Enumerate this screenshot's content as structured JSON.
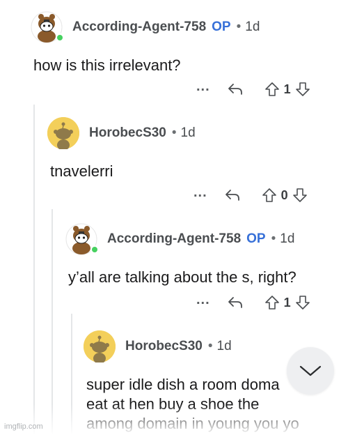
{
  "comments": [
    {
      "username": "According-Agent-758",
      "op_badge": "OP",
      "separator": "•",
      "age": "1d",
      "lines": [
        "how is this irrelevant?"
      ],
      "more": "...",
      "votes": "1",
      "avatar": "snoo-bear-avatar",
      "online": true
    },
    {
      "username": "HorobecS30",
      "separator": "•",
      "age": "1d",
      "lines": [
        "tnavelerri"
      ],
      "more": "...",
      "votes": "0",
      "avatar": "default-snoo-avatar",
      "online": false
    },
    {
      "username": "According-Agent-758",
      "op_badge": "OP",
      "separator": "•",
      "age": "1d",
      "lines": [
        "y’all are talking about the s, right?"
      ],
      "more": "...",
      "votes": "1",
      "avatar": "snoo-bear-avatar",
      "online": true
    },
    {
      "username": "HorobecS30",
      "separator": "•",
      "age": "1d",
      "lines": [
        "super idle dish a room doma",
        "eat at hen buy a shoe the",
        "among domain in young you yo"
      ],
      "avatar": "default-snoo-avatar",
      "online": false
    }
  ],
  "watermark": "imgflip.com",
  "colors": {
    "op": "#3770d8",
    "online": "#46d160",
    "avatar_bg": "#f3cf5a",
    "thread_line": "#e4e6e8"
  },
  "icons": {
    "reply": "reply-arrow-icon",
    "upvote": "upvote-arrow-icon",
    "downvote": "downvote-arrow-icon",
    "scroll": "chevron-down-icon"
  }
}
